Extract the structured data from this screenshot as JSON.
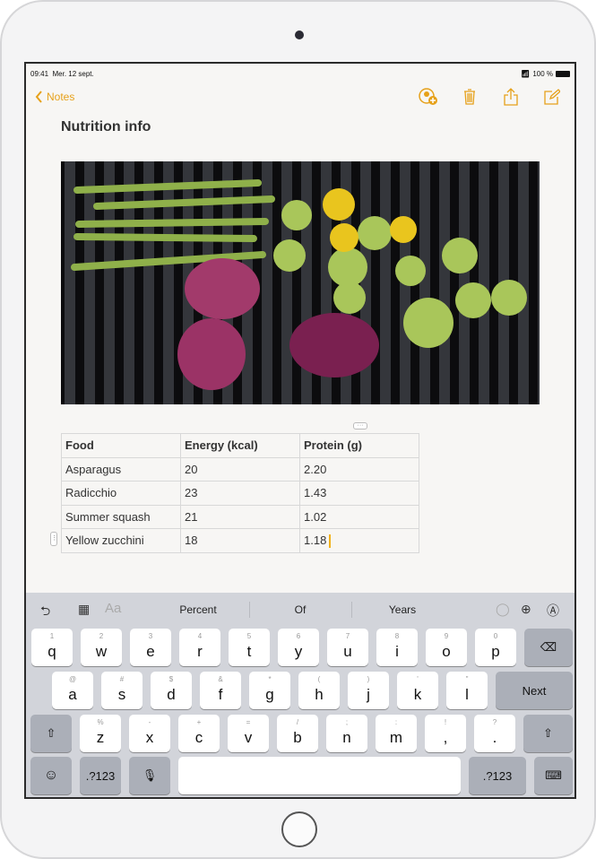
{
  "status": {
    "time": "09:41",
    "date": "Mer. 12 sept.",
    "battery": "100 %"
  },
  "nav": {
    "back_label": "Notes",
    "icons": [
      "add-person-icon",
      "trash-icon",
      "share-icon",
      "compose-icon"
    ]
  },
  "note": {
    "title": "Nutrition info"
  },
  "table": {
    "headers": [
      "Food",
      "Energy (kcal)",
      "Protein (g)"
    ],
    "rows": [
      [
        "Asparagus",
        "20",
        "2.20"
      ],
      [
        "Radicchio",
        "23",
        "1.43"
      ],
      [
        "Summer squash",
        "21",
        "1.02"
      ],
      [
        "Yellow zucchini",
        "18",
        "1.18"
      ]
    ]
  },
  "keyboard": {
    "suggestions": [
      "Percent",
      "Of",
      "Years"
    ],
    "row1": [
      [
        "1",
        "q"
      ],
      [
        "2",
        "w"
      ],
      [
        "3",
        "e"
      ],
      [
        "4",
        "r"
      ],
      [
        "5",
        "t"
      ],
      [
        "6",
        "y"
      ],
      [
        "7",
        "u"
      ],
      [
        "8",
        "i"
      ],
      [
        "9",
        "o"
      ],
      [
        "0",
        "p"
      ]
    ],
    "row2": [
      [
        "@",
        "a"
      ],
      [
        "#",
        "s"
      ],
      [
        "$",
        "d"
      ],
      [
        "&",
        "f"
      ],
      [
        "*",
        "g"
      ],
      [
        "(",
        "h"
      ],
      [
        ")",
        "j"
      ],
      [
        "'",
        "k"
      ],
      [
        "\"",
        "l"
      ]
    ],
    "row3": [
      [
        "%",
        "z"
      ],
      [
        "-",
        "x"
      ],
      [
        "+",
        "c"
      ],
      [
        "=",
        "v"
      ],
      [
        "/",
        "b"
      ],
      [
        ";",
        "n"
      ],
      [
        ":",
        "m"
      ],
      [
        "!",
        ","
      ],
      [
        "?",
        "."
      ]
    ],
    "next_label": "Next",
    "numbers_label": ".?123",
    "aa_label": "Aa"
  },
  "colors": {
    "accent": "#e6a11a"
  }
}
